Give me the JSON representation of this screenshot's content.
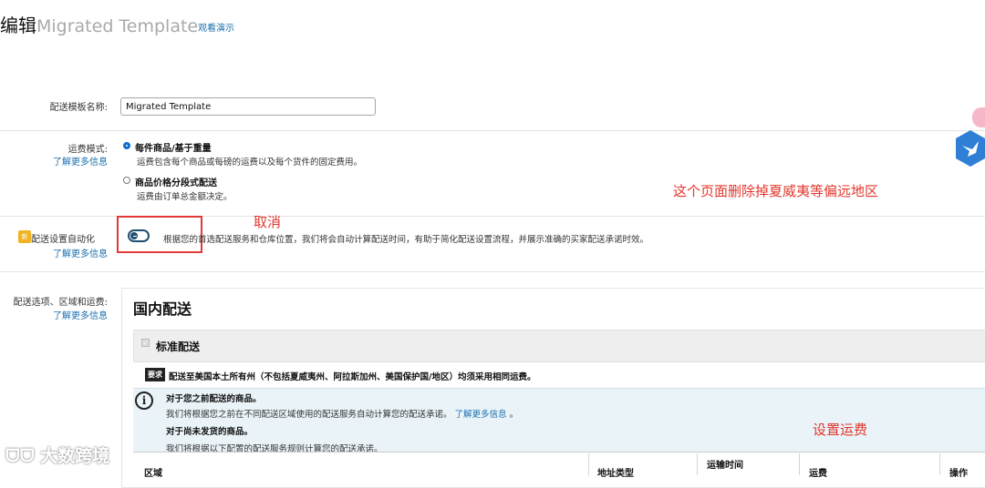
{
  "header": {
    "edit_label": "编辑",
    "template_name": "Migrated Template",
    "demo_link": "观看演示"
  },
  "name_row": {
    "label": "配送模板名称:",
    "value": "Migrated Template"
  },
  "shipping_mode": {
    "label": "运费模式:",
    "learn_more": "了解更多信息",
    "options": [
      {
        "title": "每件商品/基于重量",
        "desc": "运费包含每个商品或每磅的运费以及每个货件的固定费用。",
        "checked": true
      },
      {
        "title": "商品价格分段式配送",
        "desc": "运费由订单总金额决定。",
        "checked": false
      }
    ]
  },
  "automation": {
    "badge": "新",
    "label": "配送设置自动化",
    "learn_more": "了解更多信息",
    "desc": "根据您的首选配送服务和仓库位置，我们将会自动计算配送时间，有助于简化配送设置流程，并展示准确的买家配送承诺时效。",
    "enabled": false
  },
  "annotations": {
    "cancel": "取消",
    "remove_remote": "这个页面删除掉夏威夷等偏远地区",
    "set_fee": "设置运费"
  },
  "shipping_options": {
    "label": "配送选项、区域和运费:",
    "learn_more": "了解更多信息",
    "section_title": "国内配送",
    "standard_title": "标准配送",
    "requirement_badge": "要求",
    "requirement_text": "配送至美国本土所有州（不包括夏威夷州、阿拉斯加州、美国保护国/地区）均须采用相同运费。",
    "info": {
      "h1": "对于您之前配送的商品。",
      "p1": "我们将根据您之前在不同配送区域使用的配送服务自动计算您的配送承诺。",
      "p1_link": "了解更多信息",
      "p1_end": "。",
      "h2": "对于尚未发货的商品。",
      "p2": "我们将根据以下配置的配送服务规则计算您的配送承诺。"
    },
    "columns": [
      "区域",
      "地址类型",
      "运输时间",
      "运费",
      "操作"
    ]
  },
  "watermark": "大数跨境"
}
